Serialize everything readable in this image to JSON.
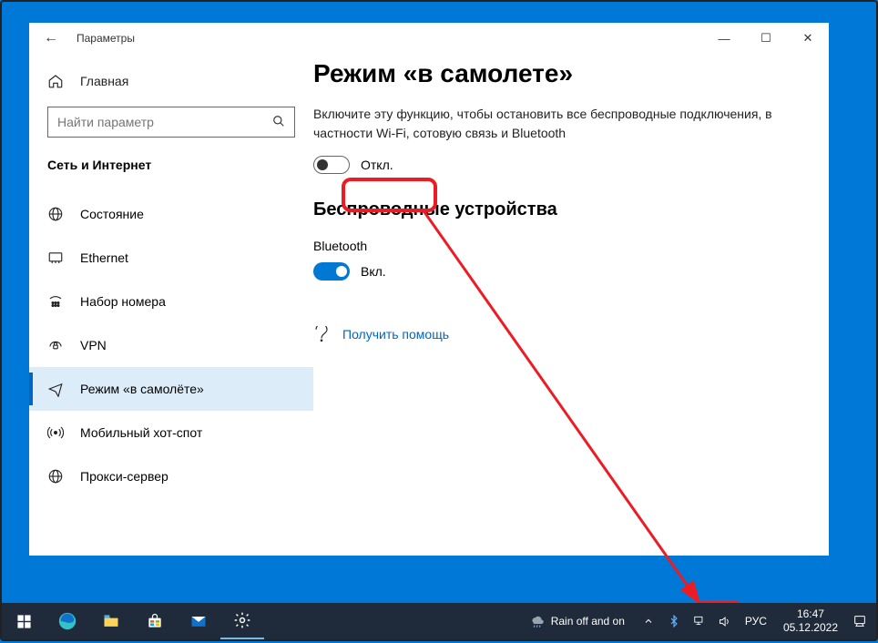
{
  "window": {
    "title": "Параметры",
    "minimize_glyph": "—",
    "maximize_glyph": "☐",
    "close_glyph": "✕",
    "back_glyph": "←"
  },
  "sidebar": {
    "home_label": "Главная",
    "search_placeholder": "Найти параметр",
    "category": "Сеть и Интернет",
    "items": [
      {
        "icon": "globe",
        "label": "Состояние"
      },
      {
        "icon": "ethernet",
        "label": "Ethernet"
      },
      {
        "icon": "dialup",
        "label": "Набор номера"
      },
      {
        "icon": "vpn",
        "label": "VPN"
      },
      {
        "icon": "airplane",
        "label": "Режим «в самолёте»",
        "active": true
      },
      {
        "icon": "hotspot",
        "label": "Мобильный хот-спот"
      },
      {
        "icon": "proxy",
        "label": "Прокси-сервер"
      }
    ]
  },
  "main": {
    "heading": "Режим «в самолете»",
    "description": "Включите эту функцию, чтобы остановить все беспроводные подключения, в частности Wi-Fi, сотовую связь и Bluetooth",
    "toggle_airplane_state": "Откл.",
    "section_heading": "Беспроводные устройства",
    "bluetooth_label": "Bluetooth",
    "toggle_bt_state": "Вкл.",
    "help_link": "Получить помощь"
  },
  "taskbar": {
    "weather": "Rain off and on",
    "lang": "РУС",
    "time": "16:47",
    "date": "05.12.2022"
  }
}
